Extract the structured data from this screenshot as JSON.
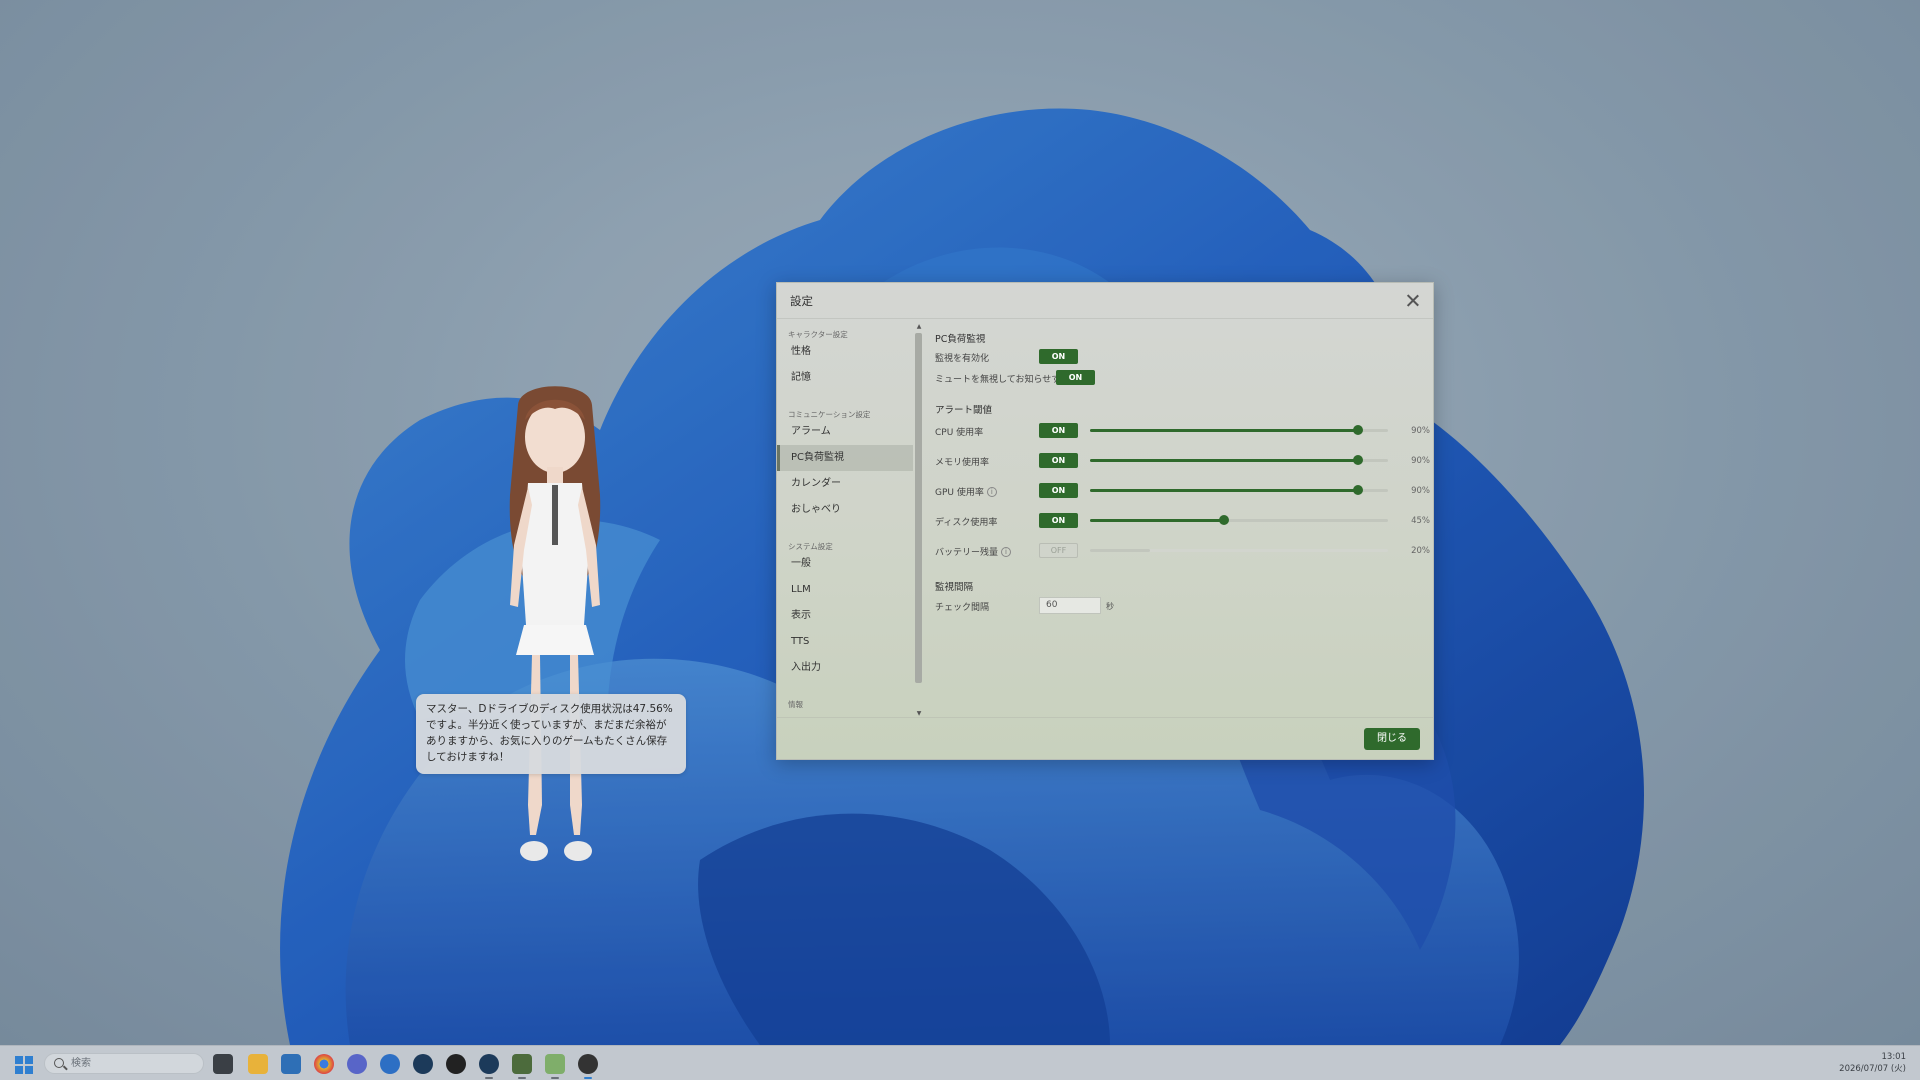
{
  "taskbar": {
    "search_placeholder": "検索",
    "time": "13:01",
    "date": "2026/07/07 (火)",
    "apps": [
      "terminal-icon",
      "file-explorer-icon",
      "store-icon",
      "chrome-icon",
      "discord-icon",
      "firefox-icon",
      "steam-icon",
      "obs-icon",
      "steam-alt-icon",
      "inkscape-icon",
      "vrm-app-icon",
      "mascot-app-icon"
    ]
  },
  "speech": {
    "line1": "マスター、Dドライブのディスク使用状況は47.56%",
    "line2": "ですよ。半分近く使っていますが、まだまだ余裕が",
    "line3": "ありますから、お気に入りのゲームもたくさん保存",
    "line4": "しておけますね！"
  },
  "dialog": {
    "title": "設定",
    "close_button": "閉じる"
  },
  "sidebar": {
    "section_character": "キャラクター設定",
    "personality": "性格",
    "memory": "記憶",
    "section_communication": "コミュニケーション設定",
    "alarm": "アラーム",
    "pc_monitor": "PC負荷監視",
    "calendar": "カレンダー",
    "chat": "おしゃべり",
    "section_system": "システム設定",
    "general": "一般",
    "llm": "LLM",
    "display": "表示",
    "tts": "TTS",
    "io": "入出力",
    "section_info": "情報"
  },
  "monitor": {
    "title": "PC負荷監視",
    "enable_label": "監視を有効化",
    "enable_state": "ON",
    "ignore_mute_label": "ミュートを無視してお知らせする",
    "ignore_mute_state": "ON",
    "threshold_title": "アラート閾値",
    "cpu_label": "CPU 使用率",
    "cpu_state": "ON",
    "cpu_value": "90%",
    "cpu_level": 0.9,
    "memory_label": "メモリ使用率",
    "memory_state": "ON",
    "memory_value": "90%",
    "memory_level": 0.9,
    "gpu_label": "GPU 使用率",
    "gpu_state": "ON",
    "gpu_value": "90%",
    "gpu_level": 0.9,
    "disk_label": "ディスク使用率",
    "disk_state": "ON",
    "disk_value": "45%",
    "disk_level": 0.45,
    "battery_label": "バッテリー残量",
    "battery_state": "OFF",
    "battery_value": "20%",
    "battery_level": 0.2,
    "interval_title": "監視間隔",
    "check_interval_label": "チェック間隔",
    "check_interval_value": "60",
    "check_interval_unit": "秒"
  },
  "colors": {
    "accent": "#2f6a2c"
  }
}
